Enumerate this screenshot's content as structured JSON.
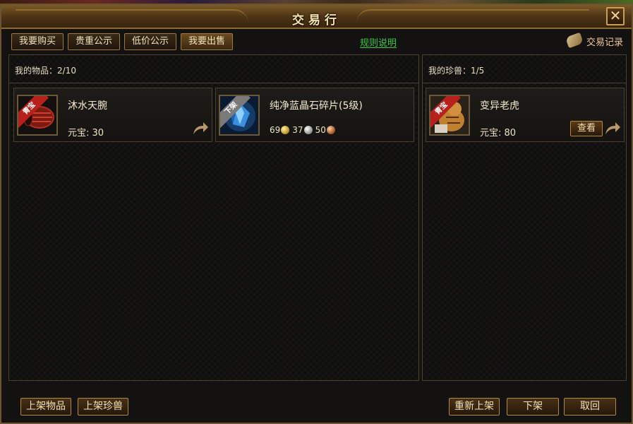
{
  "window": {
    "title": "交易行",
    "close_label": "✕"
  },
  "tabs": [
    {
      "label": "我要购买"
    },
    {
      "label": "贵重公示"
    },
    {
      "label": "低价公示"
    },
    {
      "label": "我要出售"
    }
  ],
  "rules_link": "规则说明",
  "trade_record": "交易记录",
  "my_items": {
    "header": "我的物品：2/10",
    "items": [
      {
        "name": "沐水天腕",
        "price_label": "元宝:",
        "price": "30",
        "ribbon": "青宝",
        "ribbon_color": "#b8201c"
      },
      {
        "name": "纯净蓝晶石碎片(5级)",
        "ribbon": "下架",
        "ribbon_color": "#7a7a7a",
        "gold": "69",
        "silver": "37",
        "copper": "50"
      }
    ]
  },
  "my_pets": {
    "header": "我的珍兽：1/5",
    "items": [
      {
        "name": "变异老虎",
        "price_label": "元宝:",
        "price": "80",
        "ribbon": "青宝",
        "ribbon_color": "#b8201c",
        "view_label": "查看"
      }
    ]
  },
  "bottom_buttons": {
    "list_item": "上架物品",
    "list_pet": "上架珍兽",
    "relist": "重新上架",
    "delist": "下架",
    "withdraw": "取回"
  },
  "colors": {
    "accent_gold": "#c8a050",
    "link_green": "#3ec84a",
    "ribbon_red": "#b8201c"
  }
}
